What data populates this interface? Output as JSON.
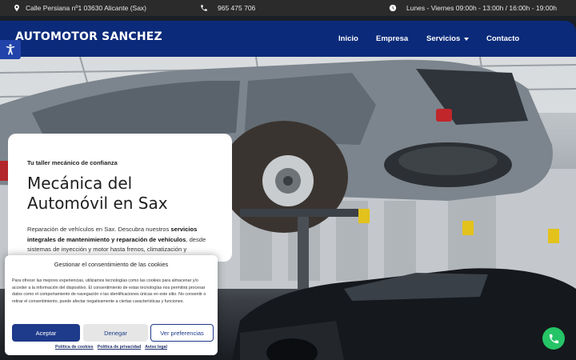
{
  "topbar": {
    "address": "Calle Persiana nº1 03630 Alicante (Sax)",
    "phone": "965 475 706",
    "hours": "Lunes - Viernes 09:00h - 13:00h / 16:00h - 19:00h"
  },
  "nav": {
    "brand": "AUTOMOTOR SANCHEZ",
    "items": [
      {
        "label": "Inicio"
      },
      {
        "label": "Empresa"
      },
      {
        "label": "Servicios"
      },
      {
        "label": "Contacto"
      }
    ]
  },
  "hero": {
    "tagline": "Tu taller mecánico de confianza",
    "title_line1": "Mecánica del",
    "title_line2": "Automóvil en Sax",
    "desc_start": "Reparación de vehículos en Sax. Descubra nuestros ",
    "desc_bold": "servicios integrales de mantenimiento y reparación de vehículos",
    "desc_end": ", desde sistemas de inyección y motor hasta frenos, climatización y"
  },
  "cookie": {
    "title": "Gestionar el consentimiento de las cookies",
    "body": "Para ofrecer las mejores experiencias, utilizamos tecnologías como las cookies para almacenar y/o acceder a la información del dispositivo. El consentimiento de estas tecnologías nos permitirá procesar datos como el comportamiento de navegación o las identificaciones únicas en este sitio. No consentir o retirar el consentimiento, puede afectar negativamente a ciertas características y funciones.",
    "accept": "Aceptar",
    "deny": "Denegar",
    "prefs": "Ver preferencias",
    "links": [
      "Política de cookies",
      "Política de privacidad",
      "Aviso legal"
    ]
  },
  "icons": {
    "address": "map-pin-icon",
    "phone": "phone-icon",
    "hours": "clock-icon",
    "accessibility": "accessibility-icon",
    "whatsapp": "whatsapp-icon"
  },
  "colors": {
    "nav": "#0b2a7a",
    "accent": "#1e3a8a",
    "whatsapp": "#25c466"
  }
}
